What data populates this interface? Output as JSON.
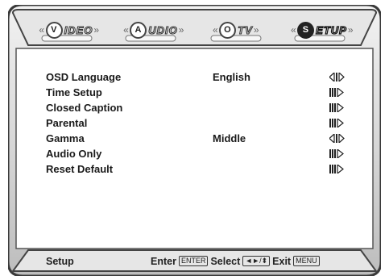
{
  "tabs": [
    {
      "brk_l": "«",
      "circle": "V",
      "label": "IDEO",
      "brk_r": "»",
      "active": false
    },
    {
      "brk_l": "«",
      "circle": "A",
      "label": "UDIO",
      "brk_r": "»",
      "active": false
    },
    {
      "brk_l": "«",
      "circle": "O",
      "label": "TV",
      "brk_r": "»",
      "active": false
    },
    {
      "brk_l": "«",
      "circle": "S",
      "label": "ETUP",
      "brk_r": "»",
      "active": true
    }
  ],
  "menu": [
    {
      "label": "OSD Language",
      "value": "English",
      "arrow": "left-right"
    },
    {
      "label": "Time Setup",
      "value": "",
      "arrow": "enter"
    },
    {
      "label": "Closed Caption",
      "value": "",
      "arrow": "enter"
    },
    {
      "label": "Parental",
      "value": "",
      "arrow": "enter"
    },
    {
      "label": "Gamma",
      "value": "Middle",
      "arrow": "left-right"
    },
    {
      "label": "Audio Only",
      "value": "",
      "arrow": "enter"
    },
    {
      "label": "Reset Default",
      "value": "",
      "arrow": "enter"
    }
  ],
  "footer": {
    "title": "Setup",
    "enter_text": "Enter",
    "enter_key": "ENTER",
    "select_text": "Select",
    "select_key": "◄►/⬍",
    "exit_text": "Exit",
    "exit_key": "MENU"
  },
  "colors": {
    "frame": "#4a4a4a",
    "frame_light": "#d8d8d8",
    "panel": "#ffffff"
  }
}
